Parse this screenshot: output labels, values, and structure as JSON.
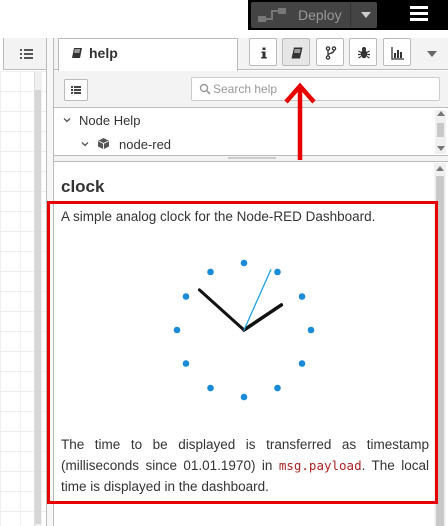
{
  "header": {
    "deploy_label": "Deploy"
  },
  "sidebar": {
    "active_tab_label": "help",
    "buttons": [
      "info-icon",
      "book-icon",
      "branch-icon",
      "bug-icon",
      "bar-chart-icon"
    ]
  },
  "help": {
    "search_placeholder": "Search help",
    "tree": {
      "root_label": "Node Help",
      "child_label": "node-red"
    },
    "node_title": "clock",
    "summary": "A simple analog clock for the Node-RED Dashboard.",
    "description_before": "The time to be displayed is transferred as timestamp (milliseconds since 01.01.1970) in ",
    "description_code": "msg.payload",
    "description_after": ". The local time is displayed in the dashboard."
  },
  "clock": {
    "dot_count": 12,
    "time_shown": "1:52",
    "hour_hand_value": 1.87,
    "minute_hand_value": 52,
    "second_hand_value": 4
  },
  "colors": {
    "annotation": "#e60000",
    "clock_dots": "#1a8bd6",
    "clock_second_hand": "#1aa3e0",
    "clock_hands": "#111111",
    "code": "#aa2222",
    "header_dark": "#000000",
    "deploy_button": "#444444"
  }
}
